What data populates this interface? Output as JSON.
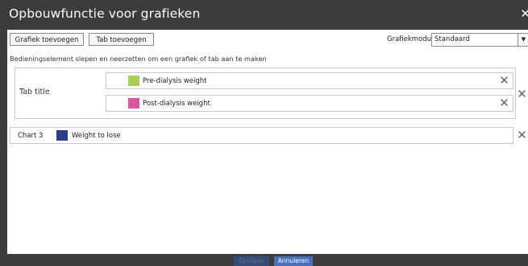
{
  "dialog": {
    "title": "Opbouwfunctie voor grafieken",
    "close_icon": "close-icon"
  },
  "toolbar": {
    "add_chart_label": "Grafiek toevoegen",
    "add_tab_label": "Tab toevoegen",
    "chart_mode_label": "Grafiekmodus",
    "chart_mode_value": "Standaard"
  },
  "instruction": "Bedieningselement slepen en neerzetten om een grafiek of tab aan te maken",
  "tab": {
    "title": "Tab title",
    "items": [
      {
        "label": "Pre-dialysis weight",
        "color": "#a6d05a"
      },
      {
        "label": "Post-dialysis weight",
        "color": "#d9559f"
      }
    ]
  },
  "chart": {
    "label": "Chart 3",
    "item": {
      "label": "Weight to lose",
      "color": "#2b3d8e"
    }
  },
  "footer": {
    "save_label": "Opslaan",
    "cancel_label": "Annuleren"
  }
}
